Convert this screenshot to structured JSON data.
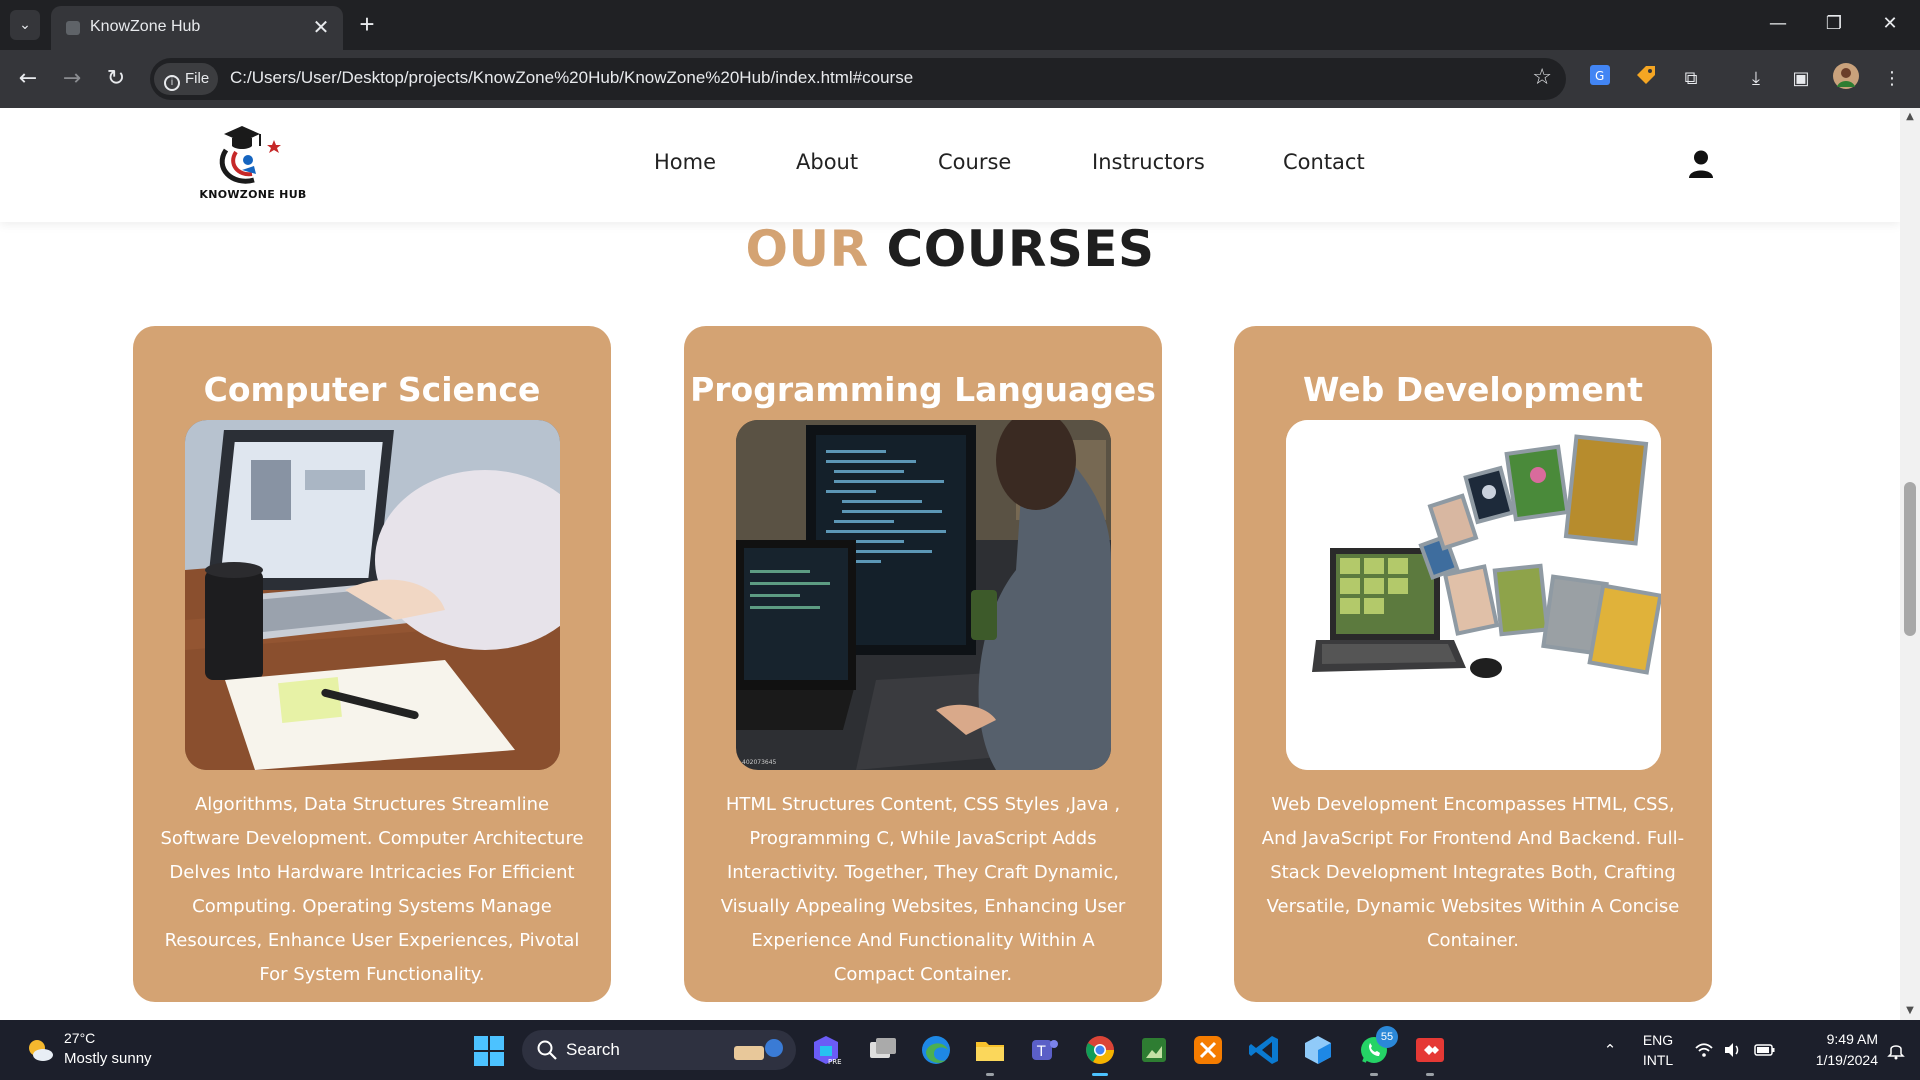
{
  "browser": {
    "tab_title": "KnowZone Hub",
    "tab_close": "✕",
    "new_tab": "+",
    "file_chip": "File",
    "url": "C:/Users/User/Desktop/projects/KnowZone%20Hub/KnowZone%20Hub/index.html#course"
  },
  "site": {
    "logo_text": "KNOWZONE HUB",
    "nav": [
      "Home",
      "About",
      "Course",
      "Instructors",
      "Contact"
    ]
  },
  "section": {
    "title_accent": "OUR",
    "title_main": "COURSES"
  },
  "courses": [
    {
      "title": "Computer Science",
      "description": "Algorithms, Data Structures Streamline Software Development. Computer Architecture Delves Into Hardware Intricacies For Efficient Computing. Operating Systems Manage Resources, Enhance User Experiences, Pivotal For System Functionality."
    },
    {
      "title": "Programming Languages",
      "description": "HTML Structures Content, CSS Styles ,Java , Programming C, While JavaScript Adds Interactivity. Together, They Craft Dynamic, Visually Appealing Websites, Enhancing User Experience And Functionality Within A Compact Container."
    },
    {
      "title": "Web Development",
      "description": "Web Development Encompasses HTML, CSS, And JavaScript For Frontend And Backend. Full-Stack Development Integrates Both, Crafting Versatile, Dynamic Websites Within A Concise Container."
    }
  ],
  "taskbar": {
    "weather_temp": "27°C",
    "weather_desc": "Mostly sunny",
    "search_label": "Search",
    "whatsapp_badge": "55",
    "lang_1": "ENG",
    "lang_2": "INTL",
    "time": "9:49 AM",
    "date": "1/19/2024"
  },
  "colors": {
    "accent": "#d4a373",
    "browser_dark": "#202124",
    "taskbar": "#1c1f2b"
  },
  "icons": {
    "user": "user-icon",
    "star": "star-icon",
    "extensions": "puzzle-icon"
  }
}
